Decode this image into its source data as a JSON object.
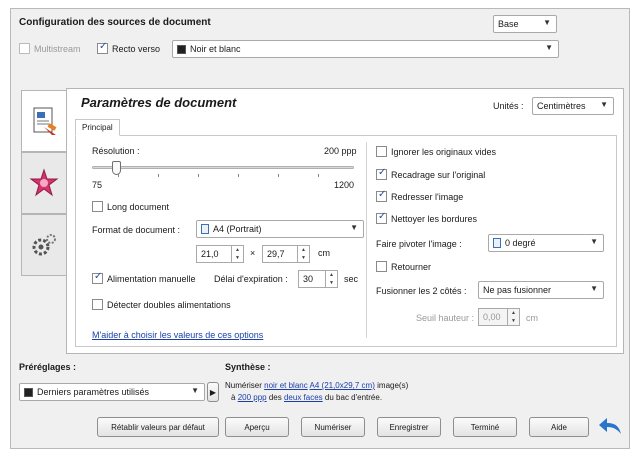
{
  "header": {
    "title": "Configuration des sources de document",
    "profile_combo": "Base",
    "multistream_label": "Multistream",
    "recto_verso_label": "Recto verso",
    "color_mode": "Noir et blanc"
  },
  "side_tabs": [
    {
      "name": "document-tab",
      "icon": "document-settings-icon"
    },
    {
      "name": "image-tab",
      "icon": "image-settings-icon"
    },
    {
      "name": "device-tab",
      "icon": "scanner-settings-icon"
    }
  ],
  "panel": {
    "title": "Paramètres de document",
    "units_label": "Unités :",
    "units_value": "Centimètres",
    "tab_label": "Principal"
  },
  "left": {
    "resolution_label": "Résolution :",
    "resolution_value": "200 ppp",
    "resolution_min": "75",
    "resolution_max": "1200",
    "resolution_level": 0.09,
    "long_document_label": "Long document",
    "format_label": "Format de document :",
    "format_value": "A4 (Portrait)",
    "width_value": "21,0",
    "times_sign": "×",
    "height_value": "29,7",
    "size_unit": "cm",
    "manual_feed_label": "Alimentation manuelle",
    "timeout_label": "Délai d'expiration :",
    "timeout_value": "30",
    "timeout_unit": "sec",
    "double_feed_label": "Détecter doubles alimentations",
    "help_link": "M'aider à choisir les valeurs de ces options"
  },
  "right": {
    "ignore_blank_label": "Ignorer les originaux vides",
    "crop_label": "Recadrage sur l'original",
    "straighten_label": "Redresser l'image",
    "clean_borders_label": "Nettoyer les bordures",
    "rotate_label": "Faire pivoter l'image :",
    "rotate_value": "0 degré",
    "flip_label": "Retourner",
    "merge_label": "Fusionner les 2 côtés :",
    "merge_value": "Ne pas fusionner",
    "threshold_label": "Seuil hauteur :",
    "threshold_value": "0,00",
    "threshold_unit": "cm"
  },
  "presets": {
    "label": "Préréglages :",
    "value": "Derniers paramètres utilisés"
  },
  "summary": {
    "label": "Synthèse :",
    "line1_prefix": "Numériser",
    "line1_color": "noir et blanc",
    "line1_size": "A4 (21,0x29,7 cm)",
    "line1_suffix": "image(s)",
    "line2_prefix": "à",
    "line2_res": "200 ppp",
    "line2_mid": "des",
    "line2_sides": "deux faces",
    "line2_suffix": "du bac d'entrée."
  },
  "buttons": {
    "reset": "Rétablir valeurs par défaut",
    "preview": "Aperçu",
    "scan": "Numériser",
    "save": "Enregistrer",
    "done": "Terminé",
    "help": "Aide"
  },
  "colors": {
    "accent_blue": "#2a74c9",
    "link_blue": "#1a3fa8"
  }
}
